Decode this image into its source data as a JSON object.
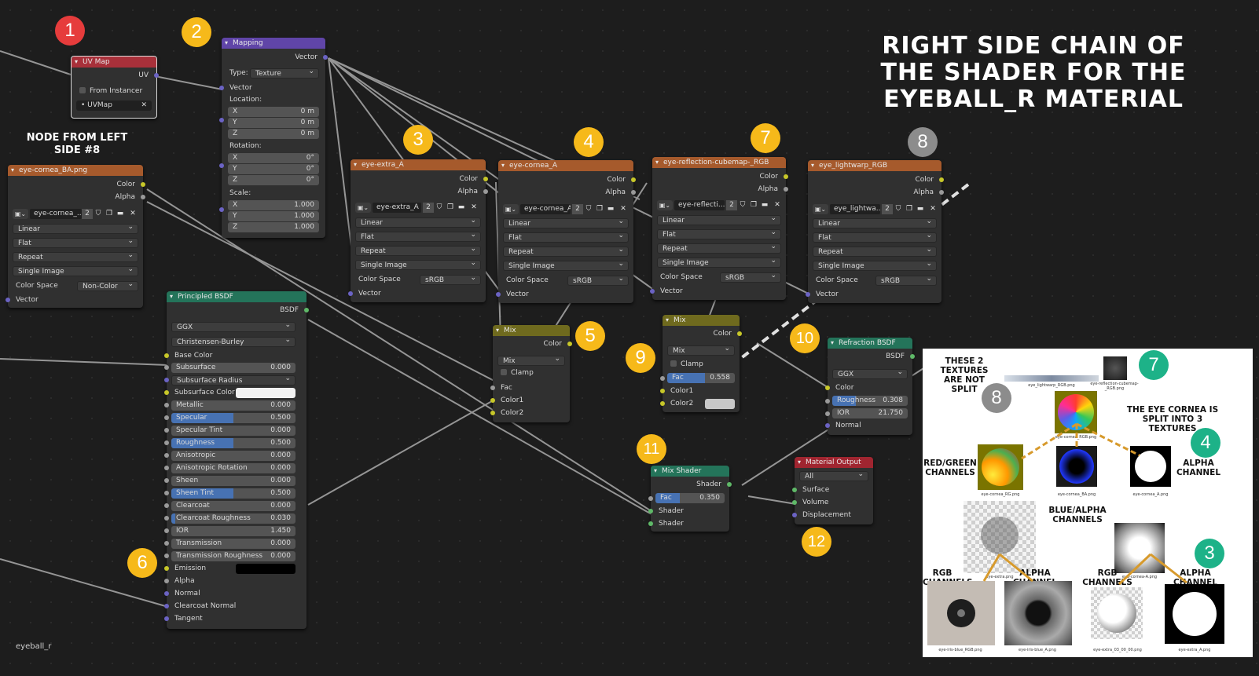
{
  "title_lines": [
    "RIGHT SIDE CHAIN OF",
    "THE SHADER FOR THE",
    "EYEBALL_R MATERIAL"
  ],
  "subtitle_lines": [
    "NODE FROM LEFT",
    "SIDE #8"
  ],
  "footer": "eyeball_r",
  "badges": [
    "1",
    "2",
    "3",
    "4",
    "5",
    "6",
    "7",
    "8",
    "9",
    "10",
    "11",
    "12"
  ],
  "uvmap": {
    "title": "UV Map",
    "out": "UV",
    "from_instancer": "From Instancer",
    "map": "UVMap"
  },
  "mapping": {
    "title": "Mapping",
    "out": "Vector",
    "type_label": "Type:",
    "type_value": "Texture",
    "vector": "Vector",
    "location": "Location:",
    "rotation": "Rotation:",
    "scale": "Scale:",
    "x": "X",
    "y": "Y",
    "z": "Z",
    "loc": [
      "0 m",
      "0 m",
      "0 m"
    ],
    "rot": [
      "0°",
      "0°",
      "0°"
    ],
    "scl": [
      "1.000",
      "1.000",
      "1.000"
    ]
  },
  "tex_left": {
    "title": "eye-cornea_BA.png",
    "color": "Color",
    "alpha": "Alpha",
    "img": "eye-cornea_...",
    "users": "2",
    "interp": "Linear",
    "proj": "Flat",
    "ext": "Repeat",
    "source": "Single Image",
    "cs_label": "Color Space",
    "cs_value": "Non-Color",
    "vector": "Vector"
  },
  "tex3": {
    "title": "eye-extra_A",
    "color": "Color",
    "alpha": "Alpha",
    "img": "eye-extra_A",
    "users": "2",
    "interp": "Linear",
    "proj": "Flat",
    "ext": "Repeat",
    "source": "Single Image",
    "cs_label": "Color Space",
    "cs_value": "sRGB",
    "vector": "Vector"
  },
  "tex4": {
    "title": "eye-cornea_A",
    "color": "Color",
    "alpha": "Alpha",
    "img": "eye-cornea_A",
    "users": "2",
    "interp": "Linear",
    "proj": "Flat",
    "ext": "Repeat",
    "source": "Single Image",
    "cs_label": "Color Space",
    "cs_value": "sRGB",
    "vector": "Vector"
  },
  "tex7": {
    "title": "eye-reflection-cubemap-_RGB",
    "color": "Color",
    "alpha": "Alpha",
    "img": "eye-reflecti...",
    "users": "2",
    "interp": "Linear",
    "proj": "Flat",
    "ext": "Repeat",
    "source": "Single Image",
    "cs_label": "Color Space",
    "cs_value": "sRGB",
    "vector": "Vector"
  },
  "tex8": {
    "title": "eye_lightwarp_RGB",
    "color": "Color",
    "alpha": "Alpha",
    "img": "eye_lightwa...",
    "users": "2",
    "interp": "Linear",
    "proj": "Flat",
    "ext": "Repeat",
    "source": "Single Image",
    "cs_label": "Color Space",
    "cs_value": "sRGB",
    "vector": "Vector"
  },
  "bsdf": {
    "title": "Principled BSDF",
    "out": "BSDF",
    "dist": "GGX",
    "sss": "Christensen-Burley",
    "base_color": "Base Color",
    "params": [
      {
        "label": "Subsurface",
        "value": "0.000",
        "fill": 0
      },
      {
        "label": "Subsurface Radius",
        "value": "",
        "fill": 0
      },
      {
        "label": "Subsurface Color",
        "value": "",
        "fill": 0
      },
      {
        "label": "Metallic",
        "value": "0.000",
        "fill": 0
      },
      {
        "label": "Specular",
        "value": "0.500",
        "fill": 0.5
      },
      {
        "label": "Specular Tint",
        "value": "0.000",
        "fill": 0
      },
      {
        "label": "Roughness",
        "value": "0.500",
        "fill": 0.5
      },
      {
        "label": "Anisotropic",
        "value": "0.000",
        "fill": 0
      },
      {
        "label": "Anisotropic Rotation",
        "value": "0.000",
        "fill": 0
      },
      {
        "label": "Sheen",
        "value": "0.000",
        "fill": 0
      },
      {
        "label": "Sheen Tint",
        "value": "0.500",
        "fill": 0.5
      },
      {
        "label": "Clearcoat",
        "value": "0.000",
        "fill": 0
      },
      {
        "label": "Clearcoat Roughness",
        "value": "0.030",
        "fill": 0.03
      },
      {
        "label": "IOR",
        "value": "1.450",
        "fill": 0
      },
      {
        "label": "Transmission",
        "value": "0.000",
        "fill": 0
      },
      {
        "label": "Transmission Roughness",
        "value": "0.000",
        "fill": 0
      }
    ],
    "emission": "Emission",
    "alpha": "Alpha",
    "normal": "Normal",
    "cc_normal": "Clearcoat Normal",
    "tangent": "Tangent"
  },
  "mix5": {
    "title": "Mix",
    "out": "Color",
    "mode": "Mix",
    "clamp": "Clamp",
    "fac": "Fac",
    "c1": "Color1",
    "c2": "Color2"
  },
  "mix9": {
    "title": "Mix",
    "out": "Color",
    "mode": "Mix",
    "clamp": "Clamp",
    "fac": "Fac",
    "fac_value": "0.558",
    "fac_fill": 0.558,
    "c1": "Color1",
    "c2": "Color2"
  },
  "refraction": {
    "title": "Refraction BSDF",
    "out": "BSDF",
    "dist": "GGX",
    "color": "Color",
    "rough": "Roughness",
    "rough_value": "0.308",
    "rough_fill": 0.308,
    "ior": "IOR",
    "ior_value": "21.750",
    "normal": "Normal"
  },
  "mixshader": {
    "title": "Mix Shader",
    "out": "Shader",
    "fac": "Fac",
    "fac_value": "0.350",
    "fac_fill": 0.35,
    "s1": "Shader",
    "s2": "Shader"
  },
  "output": {
    "title": "Material Output",
    "target": "All",
    "surface": "Surface",
    "volume": "Volume",
    "displacement": "Displacement"
  },
  "panel": {
    "t_notsplit": [
      "THESE 2",
      "TEXTURES",
      "ARE NOT",
      "SPLIT"
    ],
    "t_cornea": [
      "THE EYE CORNEA IS",
      "SPLIT INTO 3",
      "TEXTURES"
    ],
    "t_rg": [
      "RED/GREEN",
      "CHANNELS"
    ],
    "t_alpha1": [
      "ALPHA",
      "CHANNEL"
    ],
    "t_ba": [
      "BLUE/ALPHA",
      "CHANNELS"
    ],
    "t_rgb1": [
      "RGB",
      "CHANNELS"
    ],
    "t_alpha2": [
      "ALPHA",
      "CHANNEL"
    ],
    "t_rgb2": [
      "RGB",
      "CHANNELS"
    ],
    "t_alpha3": [
      "ALPHA",
      "CHANNEL"
    ],
    "caps": [
      "eye_lightwarp_RGB.png",
      "eye-reflection-cubemap-_RGB.png",
      "eye-cornea_RGB.png",
      "eye-cornea_RG.png",
      "eye-cornea_BA.png",
      "eye-cornea_A.png",
      "eye-cornea-A.png",
      "eye-extra.png",
      "eye-iris-blue_RGB.png",
      "eye-iris-blue_A.png",
      "eye-extra_03_00_00.png",
      "eye-extra_A.png"
    ]
  },
  "colors": {
    "accent_blue": "#4772b3",
    "socket_yellow": "#c7c729",
    "socket_green": "#5fb968",
    "socket_blue": "#6b63c4",
    "badge_orange": "#f6b91a",
    "badge_red": "#e63c3c",
    "badge_teal": "#1db288",
    "badge_gray": "#8c8c8c"
  }
}
